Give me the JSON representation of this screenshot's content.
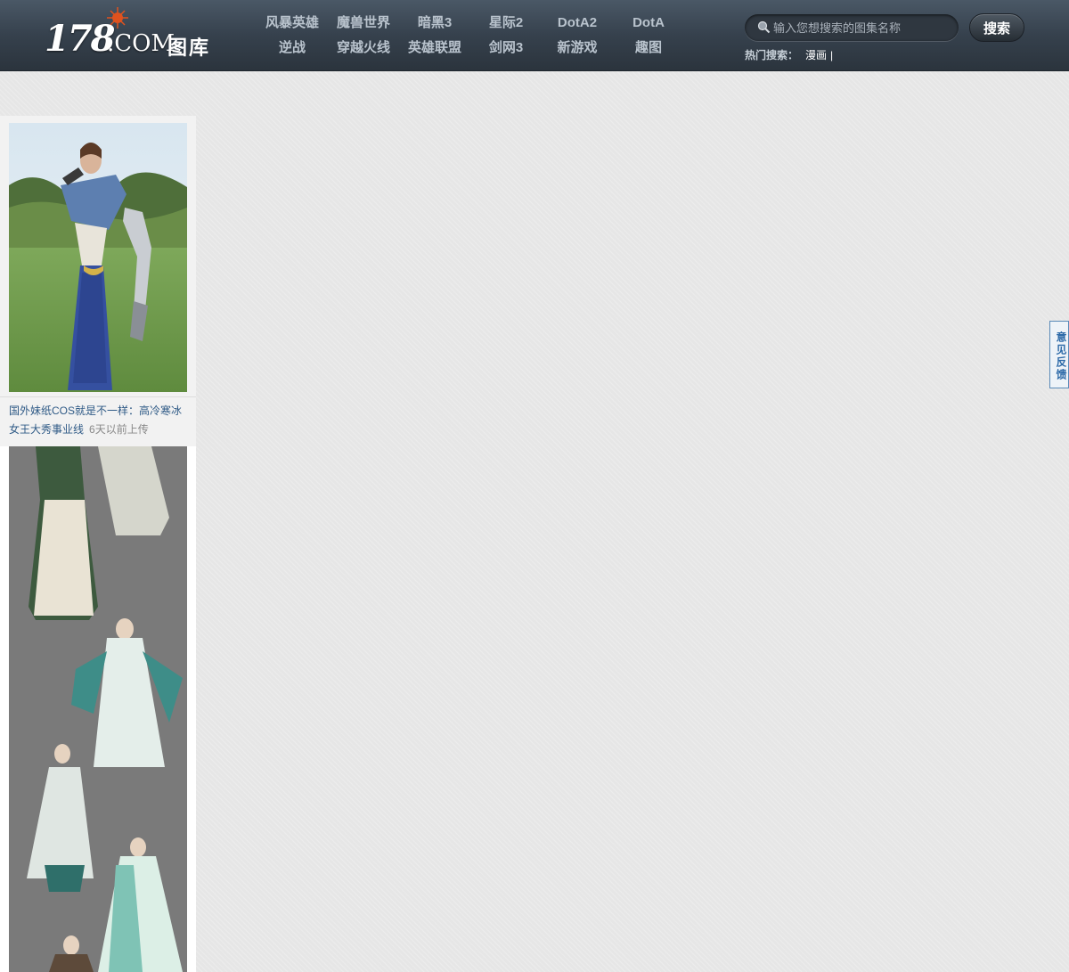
{
  "logo": {
    "number": "178",
    "domain": ".COM",
    "section": "图库"
  },
  "nav": {
    "row1": [
      "风暴英雄",
      "魔兽世界",
      "暗黑3",
      "星际2",
      "DotA2",
      "DotA"
    ],
    "row2": [
      "逆战",
      "穿越火线",
      "英雄联盟",
      "剑网3",
      "新游戏",
      "趣图"
    ]
  },
  "search": {
    "placeholder": "输入您想搜索的图集名称",
    "button_label": "搜索",
    "hot_label": "热门搜索：",
    "hot_items": [
      "漫画"
    ],
    "separator": "|"
  },
  "cards": [
    {
      "title": "国外妹纸COS就是不一样：高冷寒冰女王大秀事业线",
      "time": "6天以前上传"
    }
  ],
  "feedback_label": "意见反馈",
  "colors": {
    "header_bg": "#36414d",
    "nav_text": "#b9c3cd",
    "link": "#2f5a86",
    "feedback": "#2d6aa8"
  }
}
